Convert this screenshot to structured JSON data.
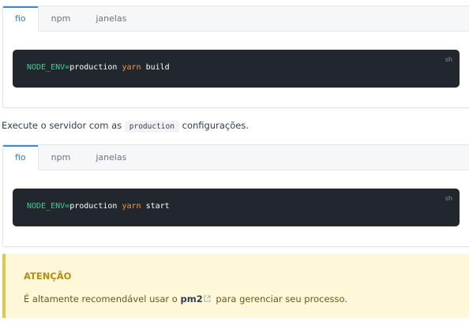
{
  "blocks": [
    {
      "tabs": [
        "fio",
        "npm",
        "janelas"
      ],
      "active_tab": 0,
      "lang": "sh",
      "code": {
        "env": "NODE_ENV",
        "eq": "=",
        "value": "production",
        "cmd": "yarn",
        "arg": "build"
      }
    },
    {
      "tabs": [
        "fio",
        "npm",
        "janelas"
      ],
      "active_tab": 0,
      "lang": "sh",
      "code": {
        "env": "NODE_ENV",
        "eq": "=",
        "value": "production",
        "cmd": "yarn",
        "arg": "start"
      }
    }
  ],
  "paragraph": {
    "before": "Execute o servidor com as",
    "code": "production",
    "after": "configurações."
  },
  "warning": {
    "title": "ATENÇÃO",
    "text_before": "É altamente recomendável usar o",
    "link": "pm2",
    "text_after": "para gerenciar seu processo."
  },
  "colors": {
    "accent": "#2b7fc4",
    "code_bg": "#22272e",
    "warning_bg": "#fef8d8",
    "warning_border": "#e6c24b"
  },
  "icons": {
    "external_link": "external-link-icon"
  }
}
